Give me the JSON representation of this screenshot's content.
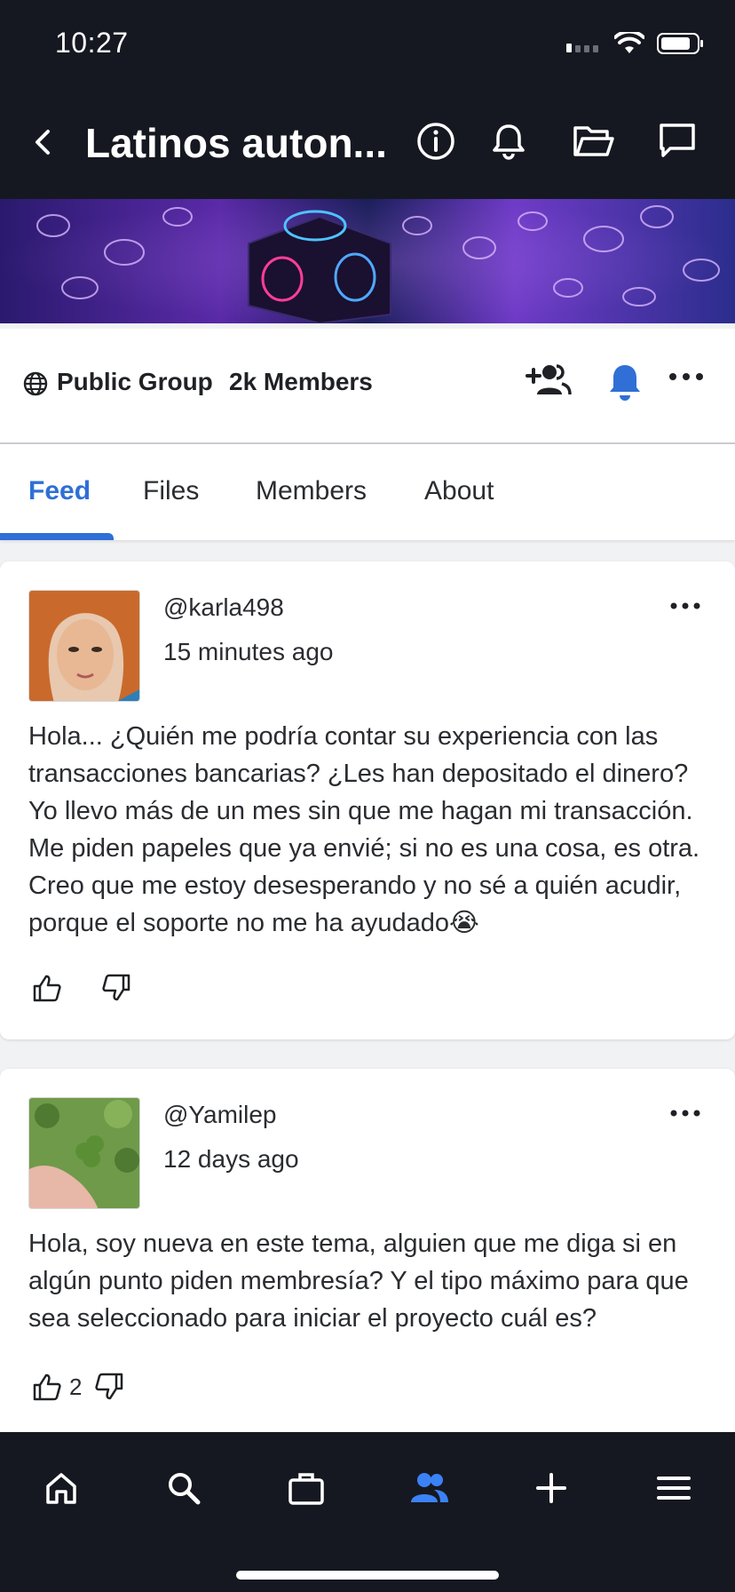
{
  "status_bar": {
    "time": "10:27"
  },
  "header": {
    "title": "Latinos auton..."
  },
  "group": {
    "type": "Public Group",
    "members": "2k Members"
  },
  "tabs": [
    {
      "label": "Feed",
      "active": true
    },
    {
      "label": "Files",
      "active": false
    },
    {
      "label": "Members",
      "active": false
    },
    {
      "label": "About",
      "active": false
    }
  ],
  "posts": [
    {
      "username": "@karla498",
      "time": "15 minutes ago",
      "body": "Hola... ¿Quién me podría contar su experiencia con las transacciones bancarias? ¿Les han depositado el dinero? Yo llevo más de un mes sin que me hagan mi transacción. Me piden papeles que ya envié; si no es una cosa, es otra. Creo que me estoy desesperando y no sé a quién acudir, porque el soporte no me ha ayudado😭",
      "likes": ""
    },
    {
      "username": "@Yamilep",
      "time": "12 days ago",
      "body": "Hola, soy nueva en este tema, alguien que me diga si en algún punto piden membresía? Y el tipo máximo para que sea seleccionado para iniciar el proyecto cuál es?",
      "likes": "2"
    }
  ],
  "colors": {
    "accent": "#2f6fd6",
    "dark": "#161821"
  },
  "bottom_nav": [
    "home-icon",
    "search-icon",
    "briefcase-icon",
    "groups-icon",
    "plus-icon",
    "menu-icon"
  ]
}
